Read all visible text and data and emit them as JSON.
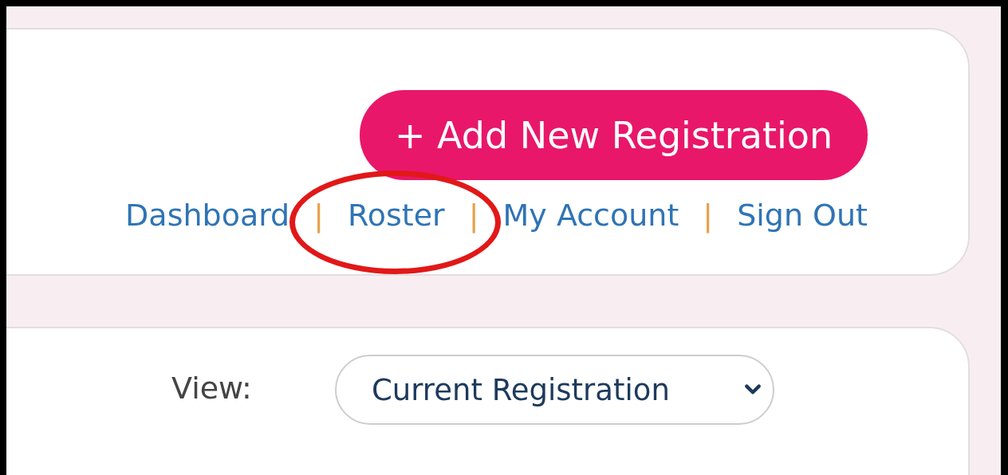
{
  "header": {
    "button": "+ Add New Registration",
    "nav": [
      {
        "kind": "link",
        "label": "Dashboard",
        "circled": false
      },
      {
        "kind": "separator",
        "label": "|"
      },
      {
        "kind": "link",
        "label": "Roster",
        "circled": true
      },
      {
        "kind": "separator",
        "label": "|"
      },
      {
        "kind": "link",
        "label": "My Account",
        "circled": false
      },
      {
        "kind": "separator",
        "label": "|"
      },
      {
        "kind": "link",
        "label": "Sign Out",
        "circled": false
      }
    ]
  },
  "filter": {
    "label": "View:",
    "select": {
      "value": "Current Registration"
    }
  }
}
